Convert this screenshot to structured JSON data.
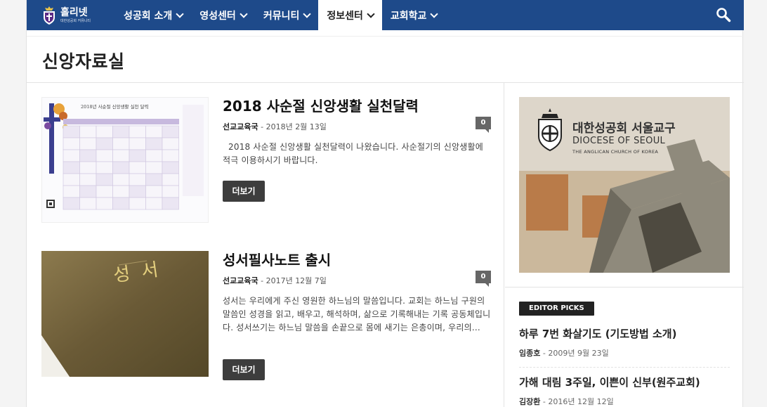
{
  "nav": {
    "logo_title": "홀리넷",
    "logo_subtitle": "대한성공회 커뮤니티",
    "menu": [
      {
        "label": "성공회 소개"
      },
      {
        "label": "영성센터"
      },
      {
        "label": "커뮤니티"
      },
      {
        "label": "정보센터",
        "active": true
      },
      {
        "label": "교회학교"
      }
    ],
    "search_icon": "search-icon",
    "bar_color": "#1e4a8a"
  },
  "page": {
    "title": "신앙자료실"
  },
  "posts": [
    {
      "title": "2018 사순절 신앙생활 실천달력",
      "author": "선교교육국",
      "date": "2018년 2월 13일",
      "comments": "0",
      "excerpt": "  2018 사순절 신앙생활 실천달력이 나왔습니다. 사순절기의 신앙생활에 적극 이용하시기 바랍니다.",
      "more": "더보기",
      "thumb_caption": "2018년 사순절 신앙생활 실천 달력"
    },
    {
      "title": "성서필사노트 출시",
      "author": "선교교육국",
      "date": "2017년 12월 7일",
      "comments": "0",
      "excerpt": "성서는 우리에게 주신 영원한 하느님의 말씀입니다. 교회는 하느님 구원의 말씀인 성경을 읽고, 배우고, 해석하며, 삶으로 기록해내는 기록 공동체입니다. 성서쓰기는 하느님 말씀을 손끝으로 몸에 새기는 은총이며, 우리의...",
      "more": "더보기",
      "thumb_caption": "성 서"
    }
  ],
  "sidebar": {
    "banner": {
      "line1": "대한성공회 서울교구",
      "line2": "DIOCESE OF SEOUL",
      "line3": "THE ANGLICAN CHURCH OF KOREA"
    },
    "editor_label": "EDITOR PICKS",
    "picks": [
      {
        "title": "하루 7번 화살기도 (기도방법 소개)",
        "author": "임종호",
        "date": "2009년 9월 23일"
      },
      {
        "title": "가해 대림 3주일, 이쁜이 신부(원주교회)",
        "author": "김장환",
        "date": "2016년 12월 12일"
      }
    ]
  }
}
